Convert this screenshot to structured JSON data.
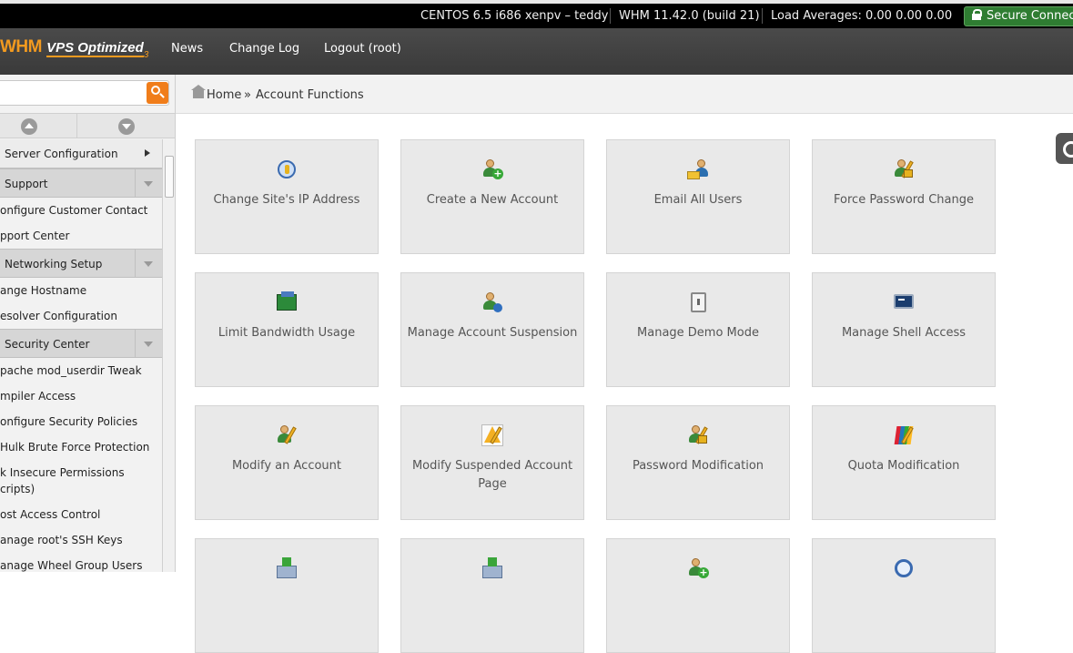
{
  "topbar": {
    "hostname": "CENTOS 6.5 i686 xenpv – teddy",
    "version": "WHM 11.42.0 (build 21)",
    "load": "Load Averages: 0.00 0.00 0.00",
    "secure": "Secure Connection"
  },
  "navbar": {
    "logo_whm": "WHM",
    "logo_vps": "VPS Optimized",
    "logo_num": "3",
    "links": [
      "News",
      "Change Log",
      "Logout (root)"
    ]
  },
  "sidebar": {
    "search_placeholder": "",
    "items": [
      {
        "type": "section",
        "label": "Server Configuration",
        "arrow": "right"
      },
      {
        "type": "section",
        "label": "Support",
        "arrow": "down"
      },
      {
        "type": "item",
        "label": "onfigure Customer Contact"
      },
      {
        "type": "item",
        "label": "pport Center"
      },
      {
        "type": "section",
        "label": "Networking Setup",
        "arrow": "down"
      },
      {
        "type": "item",
        "label": "ange Hostname"
      },
      {
        "type": "item",
        "label": "esolver Configuration"
      },
      {
        "type": "section",
        "label": "Security Center",
        "arrow": "down"
      },
      {
        "type": "item",
        "label": "pache mod_userdir Tweak"
      },
      {
        "type": "item",
        "label": "mpiler Access"
      },
      {
        "type": "item",
        "label": "onfigure Security Policies"
      },
      {
        "type": "item",
        "label": "Hulk Brute Force Protection"
      },
      {
        "type": "item2",
        "label": "k Insecure Permissions",
        "label2": "cripts)"
      },
      {
        "type": "item",
        "label": "ost Access Control"
      },
      {
        "type": "item",
        "label": "anage root's SSH Keys"
      },
      {
        "type": "item",
        "label": "anage Wheel Group Users"
      }
    ]
  },
  "breadcrumb": {
    "home": "Home",
    "separator": "»",
    "current": "Account Functions"
  },
  "tiles": [
    {
      "label": "Change Site's IP Address",
      "icon": "ip-address-icon"
    },
    {
      "label": "Create a New Account",
      "icon": "create-account-icon"
    },
    {
      "label": "Email All Users",
      "icon": "email-users-icon"
    },
    {
      "label": "Force Password Change",
      "icon": "force-password-icon"
    },
    {
      "label": "Limit Bandwidth Usage",
      "icon": "bandwidth-icon"
    },
    {
      "label": "Manage Account Suspension",
      "icon": "suspension-icon"
    },
    {
      "label": "Manage Demo Mode",
      "icon": "demo-mode-icon"
    },
    {
      "label": "Manage Shell Access",
      "icon": "shell-icon"
    },
    {
      "label": "Modify an Account",
      "icon": "modify-account-icon"
    },
    {
      "label": "Modify Suspended Account Page",
      "icon": "suspended-page-icon"
    },
    {
      "label": "Password Modification",
      "icon": "password-icon"
    },
    {
      "label": "Quota Modification",
      "icon": "quota-icon"
    },
    {
      "label": "",
      "icon": "download-icon"
    },
    {
      "label": "",
      "icon": "download-icon"
    },
    {
      "label": "",
      "icon": "user-icon"
    },
    {
      "label": "",
      "icon": "globe-icon"
    }
  ]
}
